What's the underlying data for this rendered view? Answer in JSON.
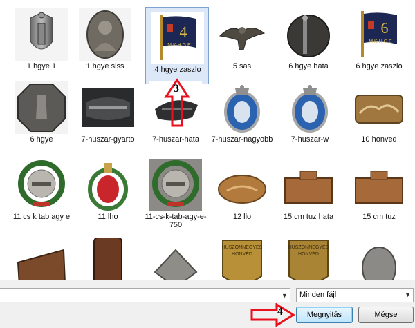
{
  "files": [
    {
      "label": "1 hgye 1",
      "icon": "badge-shield-1-icon"
    },
    {
      "label": "1 hgye siss",
      "icon": "badge-portrait-oval-icon"
    },
    {
      "label": "4 hgye zaszlo",
      "icon": "flag-4-icon",
      "selected": true
    },
    {
      "label": "5 sas",
      "icon": "eagle-badge-icon"
    },
    {
      "label": "6 hgye hata",
      "icon": "badge-back-pin-icon"
    },
    {
      "label": "6 hgye zaszlo",
      "icon": "flag-6-icon"
    },
    {
      "label": "6 hgye",
      "icon": "badge-octagon-soldier-icon"
    },
    {
      "label": "7-huszar-gyarto",
      "icon": "badge-back-photo-icon"
    },
    {
      "label": "7-huszar-hata",
      "icon": "badge-back-dark-icon"
    },
    {
      "label": "7-huszar-nagyobb",
      "icon": "badge-blue-oval-crown-icon"
    },
    {
      "label": "7-huszar-w",
      "icon": "badge-blue-oval-crown-icon"
    },
    {
      "label": "10 honved",
      "icon": "badge-plaque-horses-icon"
    },
    {
      "label": "11 cs k tab agy e",
      "icon": "badge-wreath-cannon-icon"
    },
    {
      "label": "11 lho",
      "icon": "badge-red-wreath-icon"
    },
    {
      "label": "11-cs-k-tab-agy-e-750",
      "icon": "badge-wreath-cannon-icon"
    },
    {
      "label": "12 llo",
      "icon": "badge-oval-copper-icon"
    },
    {
      "label": "15 cm tuz hata",
      "icon": "badge-copper-plaque-icon"
    },
    {
      "label": "15 cm tuz",
      "icon": "badge-copper-plaque-icon"
    },
    {
      "label": "",
      "icon": "badge-bronze-soldiers-icon"
    },
    {
      "label": "",
      "icon": "badge-bronze-tall-icon"
    },
    {
      "label": "",
      "icon": "badge-silver-plane-icon"
    },
    {
      "label": "",
      "icon": "badge-huszonnegyes-honved-icon",
      "text": "HUSZONNEGYES HONVÉD"
    },
    {
      "label": "",
      "icon": "badge-huszonnegyes-honved-icon",
      "text": "HUSZONNEGYES HONVÉD"
    },
    {
      "label": "",
      "icon": "badge-soldier-oval-icon"
    }
  ],
  "filename": {
    "value": ""
  },
  "filter": {
    "selected": "Minden fájl"
  },
  "buttons": {
    "open": "Megnyitás",
    "cancel": "Mégse"
  },
  "annotations": {
    "three": "3",
    "four": "4"
  },
  "colors": {
    "selection": "#dce8f8",
    "selection_border": "#7da2ce",
    "annotation_arrow": "#e8111d"
  }
}
